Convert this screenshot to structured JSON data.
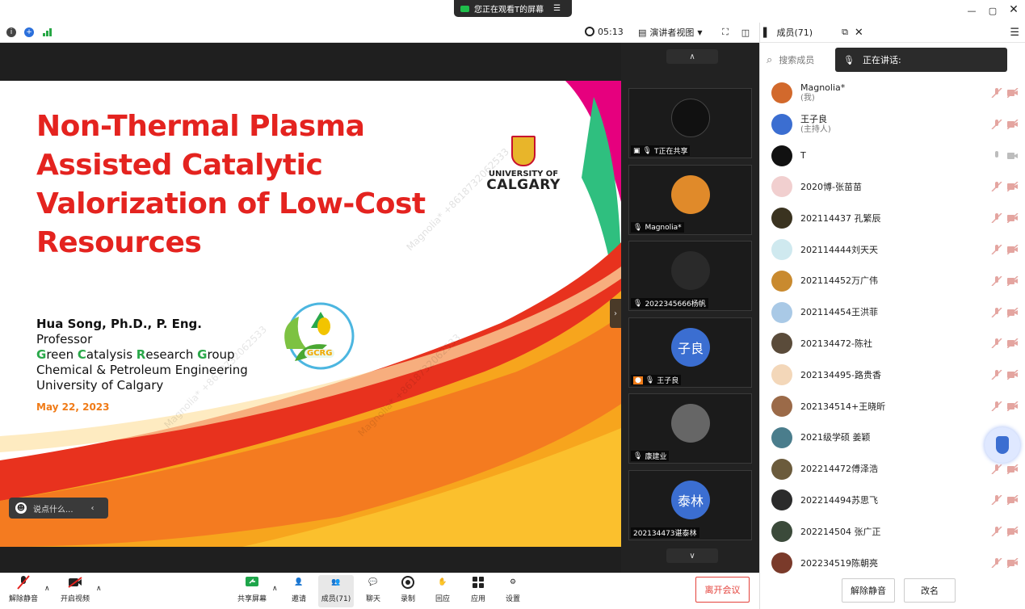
{
  "window": {
    "share_banner": "您正在观看T的屏幕",
    "timer": "05:13",
    "view_mode": "演讲者视图"
  },
  "slide": {
    "title_lines": [
      "Non-Thermal Plasma",
      "Assisted Catalytic",
      "Valorization of Low-Cost",
      "Resources"
    ],
    "author": "Hua Song, Ph.D., P. Eng.",
    "position": "Professor",
    "group": "Green Catalysis Research Group",
    "dept": "Chemical & Petroleum Engineering",
    "univ": "University of Calgary",
    "date": "May 22, 2023",
    "uc_logo_line1": "UNIVERSITY OF",
    "uc_logo_line2": "CALGARY",
    "gcrg_logo": "GCRG",
    "watermark": "Magnolia* +8618732062533",
    "chat_placeholder": "说点什么..."
  },
  "gallery": [
    {
      "label": "T正在共享",
      "avatar_text": "",
      "color": "#111111"
    },
    {
      "label": "Magnolia*",
      "avatar_text": "",
      "color": "#e08a2a"
    },
    {
      "label": "2022345666杨帆",
      "avatar_text": "",
      "color": "#2a2a2a"
    },
    {
      "label": "王子良",
      "avatar_text": "子良",
      "color": "#3b6ed1"
    },
    {
      "label": "康建业",
      "avatar_text": "",
      "color": "#666666"
    },
    {
      "label": "202134473谌泰林",
      "avatar_text": "泰林",
      "color": "#3b6ed1"
    }
  ],
  "panel": {
    "tab_label": "成员(71)",
    "search_placeholder": "搜索成员",
    "speaking_label": "正在讲话:",
    "members": [
      {
        "name": "Magnolia*",
        "sub": "(我)",
        "color": "#d2692c",
        "icon": "muted"
      },
      {
        "name": "王子良",
        "sub": "(主持人)",
        "color": "#3b6ed1",
        "icon": "muted"
      },
      {
        "name": "T",
        "sub": "",
        "color": "#111111",
        "icon": "active"
      },
      {
        "name": "2020博-张苗苗",
        "sub": "",
        "color": "#f1cfcf",
        "icon": "muted"
      },
      {
        "name": "202114437 孔繁辰",
        "sub": "",
        "color": "#3a3320",
        "icon": "muted"
      },
      {
        "name": "202114444刘天天",
        "sub": "",
        "color": "#cfe9ef",
        "icon": "muted"
      },
      {
        "name": "202114452万广伟",
        "sub": "",
        "color": "#c98a2f",
        "icon": "muted"
      },
      {
        "name": "202114454王洪菲",
        "sub": "",
        "color": "#a9c9e6",
        "icon": "muted"
      },
      {
        "name": "202134472-陈社",
        "sub": "",
        "color": "#5a4b3a",
        "icon": "muted"
      },
      {
        "name": "202134495-路贵香",
        "sub": "",
        "color": "#f3d7b9",
        "icon": "muted"
      },
      {
        "name": "202134514+王晓昕",
        "sub": "",
        "color": "#9b6a48",
        "icon": "muted"
      },
      {
        "name": "2021级学硕 姜颖",
        "sub": "",
        "color": "#4a7d8c",
        "icon": "none"
      },
      {
        "name": "202214472傅泽浩",
        "sub": "",
        "color": "#6b5b3c",
        "icon": "muted"
      },
      {
        "name": "202214494苏思飞",
        "sub": "",
        "color": "#2b2b2b",
        "icon": "muted"
      },
      {
        "name": "202214504 张广正",
        "sub": "",
        "color": "#3b4a3a",
        "icon": "muted"
      },
      {
        "name": "202234519陈朝亮",
        "sub": "",
        "color": "#7a3a2a",
        "icon": "muted"
      }
    ],
    "unmute_all": "解除静音",
    "rename": "改名"
  },
  "toolbar": {
    "unmute": "解除静音",
    "video": "开启视频",
    "share": "共享屏幕",
    "invite": "邀请",
    "members": "成员(71)",
    "chat": "聊天",
    "record": "录制",
    "reaction": "回应",
    "apps": "应用",
    "settings": "设置",
    "leave": "离开会议"
  },
  "colors": {
    "accent_red": "#e4231f",
    "leave_red": "#e4423b",
    "date_orange": "#f07b17",
    "bg_dark": "#1f1f1f"
  }
}
